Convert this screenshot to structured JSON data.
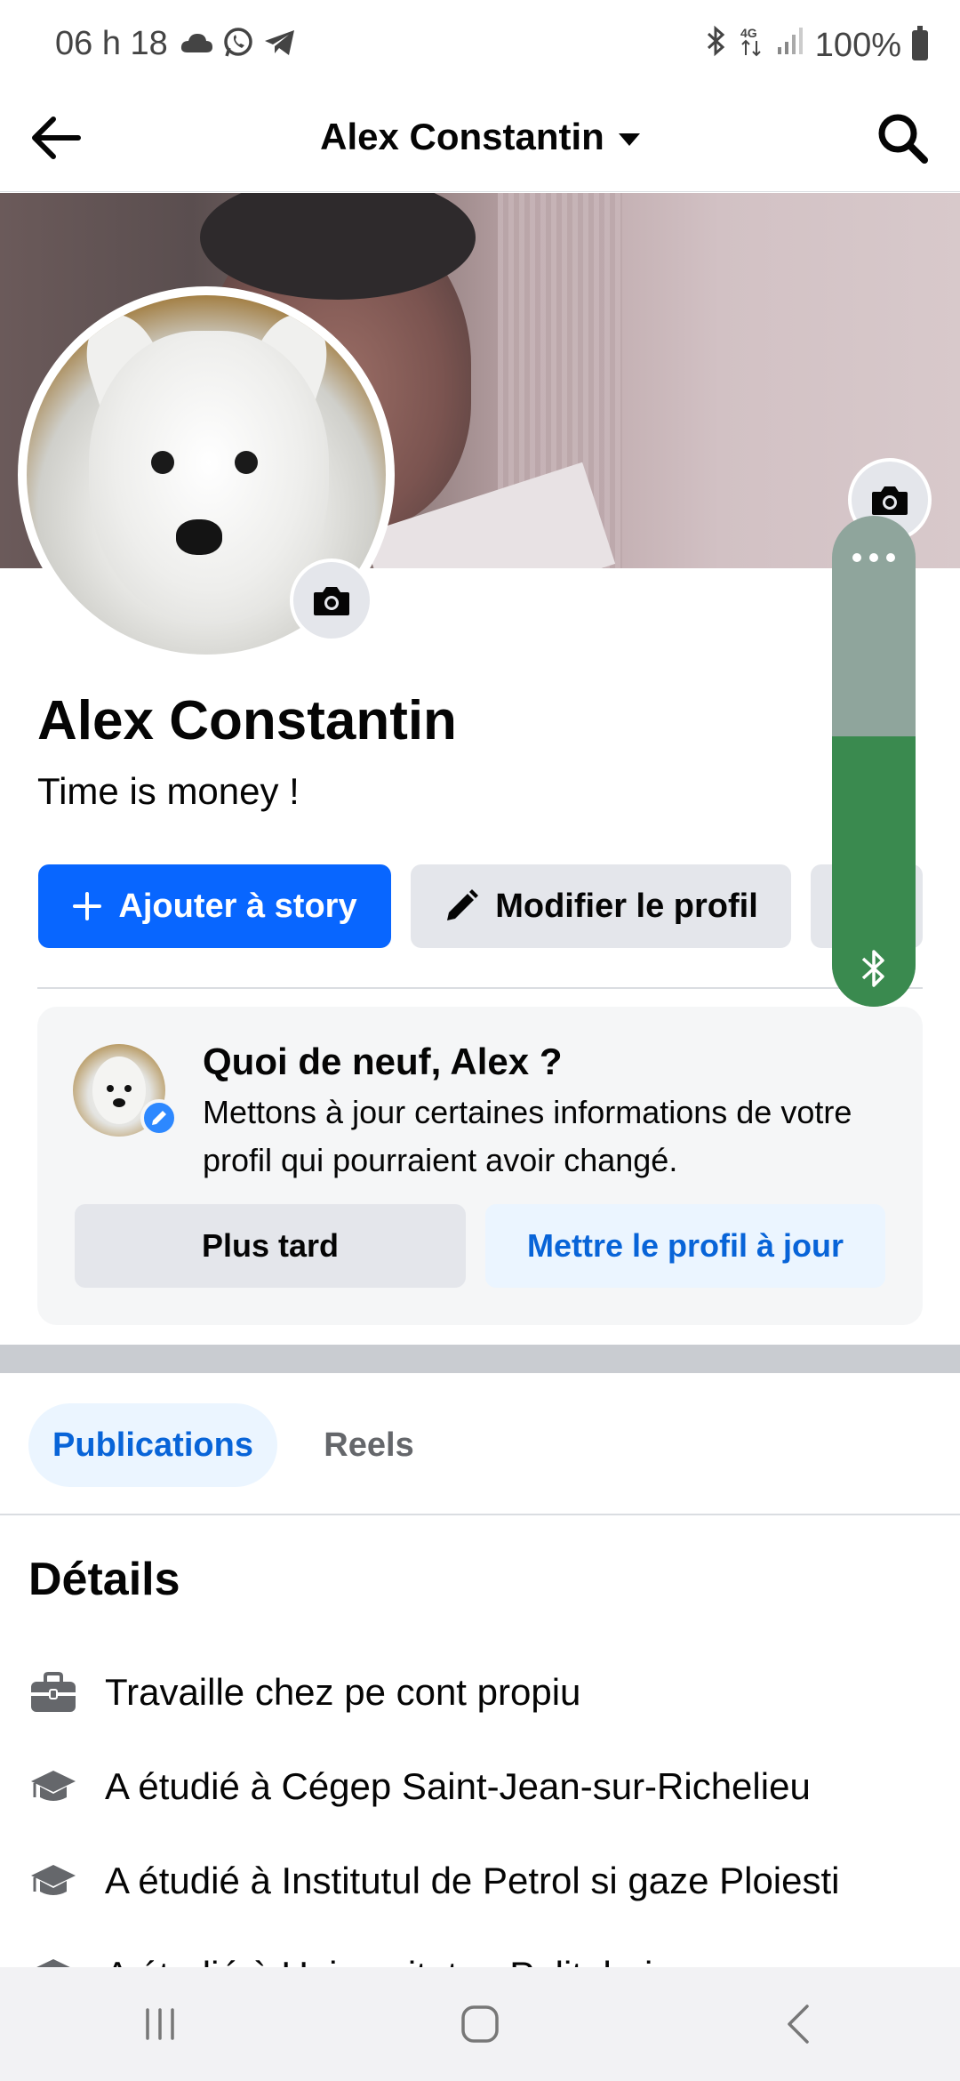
{
  "status_bar": {
    "time": "06 h 18",
    "battery": "100%",
    "icons_left": [
      "cloud-icon",
      "whatsapp-icon",
      "telegram-icon"
    ],
    "icons_right": [
      "bluetooth-icon",
      "4g-icon",
      "signal-icon",
      "battery-icon"
    ]
  },
  "header": {
    "title": "Alex Constantin"
  },
  "profile": {
    "name": "Alex Constantin",
    "bio": "Time is money !"
  },
  "actions": {
    "add_story": "Ajouter à story",
    "edit_profile": "Modifier le profil"
  },
  "update_card": {
    "title": "Quoi de neuf, Alex ?",
    "text": "Mettons à jour certaines informations de votre profil qui pourraient avoir changé.",
    "later": "Plus tard",
    "update": "Mettre le profil à jour"
  },
  "tabs": {
    "publications": "Publications",
    "reels": "Reels"
  },
  "details": {
    "title": "Détails",
    "items": [
      {
        "icon": "briefcase-icon",
        "text": "Travaille chez pe cont propiu"
      },
      {
        "icon": "graduation-cap-icon",
        "text": "A étudié à Cégep Saint-Jean-sur-Richelieu"
      },
      {
        "icon": "graduation-cap-icon",
        "text": "A étudié à Institutul de Petrol si gaze Ploiesti"
      },
      {
        "icon": "graduation-cap-icon",
        "text": "A étudié à Universitatea Politehnica"
      }
    ]
  },
  "volume_overlay": {
    "level": 0.55
  },
  "colors": {
    "primary": "#0866ff",
    "secondary_bg": "#e4e6eb",
    "link_blue": "#0864d8",
    "volume_green": "#3a8a4f"
  }
}
